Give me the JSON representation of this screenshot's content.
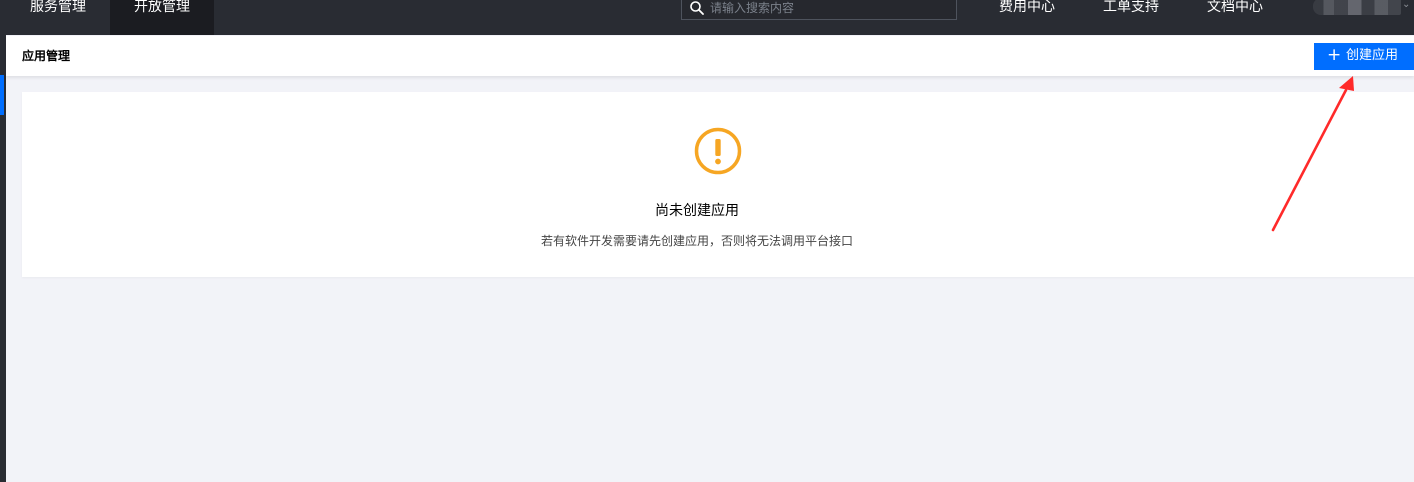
{
  "topbar": {
    "tabs": [
      {
        "label": "服务管理",
        "active": false
      },
      {
        "label": "开放管理",
        "active": true
      }
    ],
    "search": {
      "placeholder": "请输入搜索内容",
      "value": "",
      "icon": "search-icon"
    },
    "links": [
      {
        "label": "费用中心"
      },
      {
        "label": "工单支持"
      },
      {
        "label": "文档中心"
      }
    ]
  },
  "header": {
    "title": "应用管理",
    "create_button": {
      "label": "创建应用",
      "icon": "plus-icon"
    }
  },
  "empty_state": {
    "icon": "warning-circle-icon",
    "title": "尚未创建应用",
    "description": "若有软件开发需要请先创建应用，否则将无法调用平台接口"
  },
  "colors": {
    "topbar_bg": "#292c33",
    "active_tab_bg": "#1b1c21",
    "primary": "#006eff",
    "warning": "#f6a623",
    "annotation": "#ff2a2a",
    "page_bg": "#f2f3f8"
  }
}
